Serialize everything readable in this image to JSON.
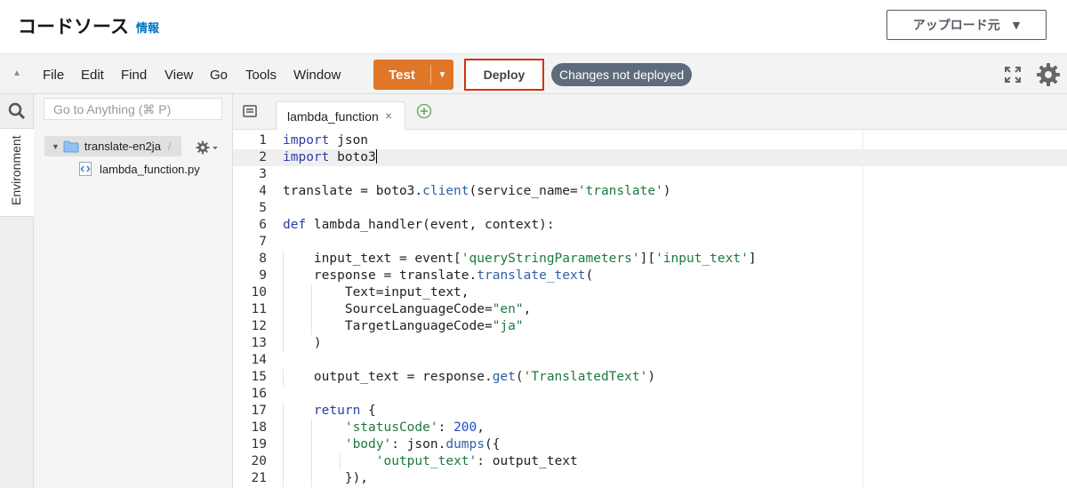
{
  "header": {
    "title": "コードソース",
    "info_link": "情報",
    "upload_button": "アップロード元"
  },
  "toolbar": {
    "menu": [
      "File",
      "Edit",
      "Find",
      "View",
      "Go",
      "Tools",
      "Window"
    ],
    "test_label": "Test",
    "deploy_label": "Deploy",
    "status_badge": "Changes not deployed"
  },
  "sidebar": {
    "environment_tab": "Environment",
    "goto_placeholder": "Go to Anything (⌘ P)",
    "folder_name": "translate-en2ja",
    "folder_suffix": "/",
    "file_name": "lambda_function.py"
  },
  "editor": {
    "tab_label": "lambda_function",
    "active_line": 2,
    "lines": [
      {
        "n": "1",
        "tokens": [
          [
            "kw",
            "import"
          ],
          [
            "t",
            " json"
          ]
        ]
      },
      {
        "n": "2",
        "tokens": [
          [
            "kw",
            "import"
          ],
          [
            "t",
            " boto3"
          ]
        ],
        "cursor": true
      },
      {
        "n": "3",
        "tokens": []
      },
      {
        "n": "4",
        "tokens": [
          [
            "t",
            "translate = boto3."
          ],
          [
            "fn",
            "client"
          ],
          [
            "t",
            "(service_name="
          ],
          [
            "str",
            "'translate'"
          ],
          [
            "t",
            ")"
          ]
        ]
      },
      {
        "n": "5",
        "tokens": []
      },
      {
        "n": "6",
        "tokens": [
          [
            "kw",
            "def"
          ],
          [
            "t",
            " lambda_handler(event, context):"
          ]
        ]
      },
      {
        "n": "7",
        "tokens": []
      },
      {
        "n": "8",
        "indent": 1,
        "tokens": [
          [
            "t",
            "    input_text = event["
          ],
          [
            "str",
            "'queryStringParameters'"
          ],
          [
            "t",
            "]["
          ],
          [
            "str",
            "'input_text'"
          ],
          [
            "t",
            "]"
          ]
        ]
      },
      {
        "n": "9",
        "indent": 1,
        "tokens": [
          [
            "t",
            "    response = translate."
          ],
          [
            "fn",
            "translate_text"
          ],
          [
            "t",
            "("
          ]
        ]
      },
      {
        "n": "10",
        "indent": 2,
        "tokens": [
          [
            "t",
            "        Text=input_text,"
          ]
        ]
      },
      {
        "n": "11",
        "indent": 2,
        "tokens": [
          [
            "t",
            "        SourceLanguageCode="
          ],
          [
            "str",
            "\"en\""
          ],
          [
            "t",
            ","
          ]
        ]
      },
      {
        "n": "12",
        "indent": 2,
        "tokens": [
          [
            "t",
            "        TargetLanguageCode="
          ],
          [
            "str",
            "\"ja\""
          ]
        ]
      },
      {
        "n": "13",
        "indent": 1,
        "tokens": [
          [
            "t",
            "    )"
          ]
        ]
      },
      {
        "n": "14",
        "tokens": []
      },
      {
        "n": "15",
        "indent": 1,
        "tokens": [
          [
            "t",
            "    output_text = response."
          ],
          [
            "fn",
            "get"
          ],
          [
            "t",
            "("
          ],
          [
            "str",
            "'TranslatedText'"
          ],
          [
            "t",
            ")"
          ]
        ]
      },
      {
        "n": "16",
        "tokens": []
      },
      {
        "n": "17",
        "indent": 1,
        "tokens": [
          [
            "t",
            "    "
          ],
          [
            "kw",
            "return"
          ],
          [
            "t",
            " {"
          ]
        ]
      },
      {
        "n": "18",
        "indent": 2,
        "tokens": [
          [
            "t",
            "        "
          ],
          [
            "str",
            "'statusCode'"
          ],
          [
            "t",
            ": "
          ],
          [
            "num",
            "200"
          ],
          [
            "t",
            ","
          ]
        ]
      },
      {
        "n": "19",
        "indent": 2,
        "tokens": [
          [
            "t",
            "        "
          ],
          [
            "str",
            "'body'"
          ],
          [
            "t",
            ": json."
          ],
          [
            "fn",
            "dumps"
          ],
          [
            "t",
            "({"
          ]
        ]
      },
      {
        "n": "20",
        "indent": 3,
        "tokens": [
          [
            "t",
            "            "
          ],
          [
            "str",
            "'output_text'"
          ],
          [
            "t",
            ": output_text"
          ]
        ]
      },
      {
        "n": "21",
        "indent": 2,
        "tokens": [
          [
            "t",
            "        }),"
          ]
        ]
      }
    ]
  },
  "colors": {
    "accent_orange": "#e07628",
    "deploy_border": "#d13212",
    "link_blue": "#0073bb",
    "badge_gray": "#5f6b7a"
  },
  "icons": [
    "collapse-arrow-icon",
    "dropdown-caret-icon",
    "fullscreen-icon",
    "gear-icon",
    "search-icon",
    "folder-icon",
    "python-file-icon",
    "tab-list-icon",
    "add-tab-icon",
    "close-icon"
  ]
}
